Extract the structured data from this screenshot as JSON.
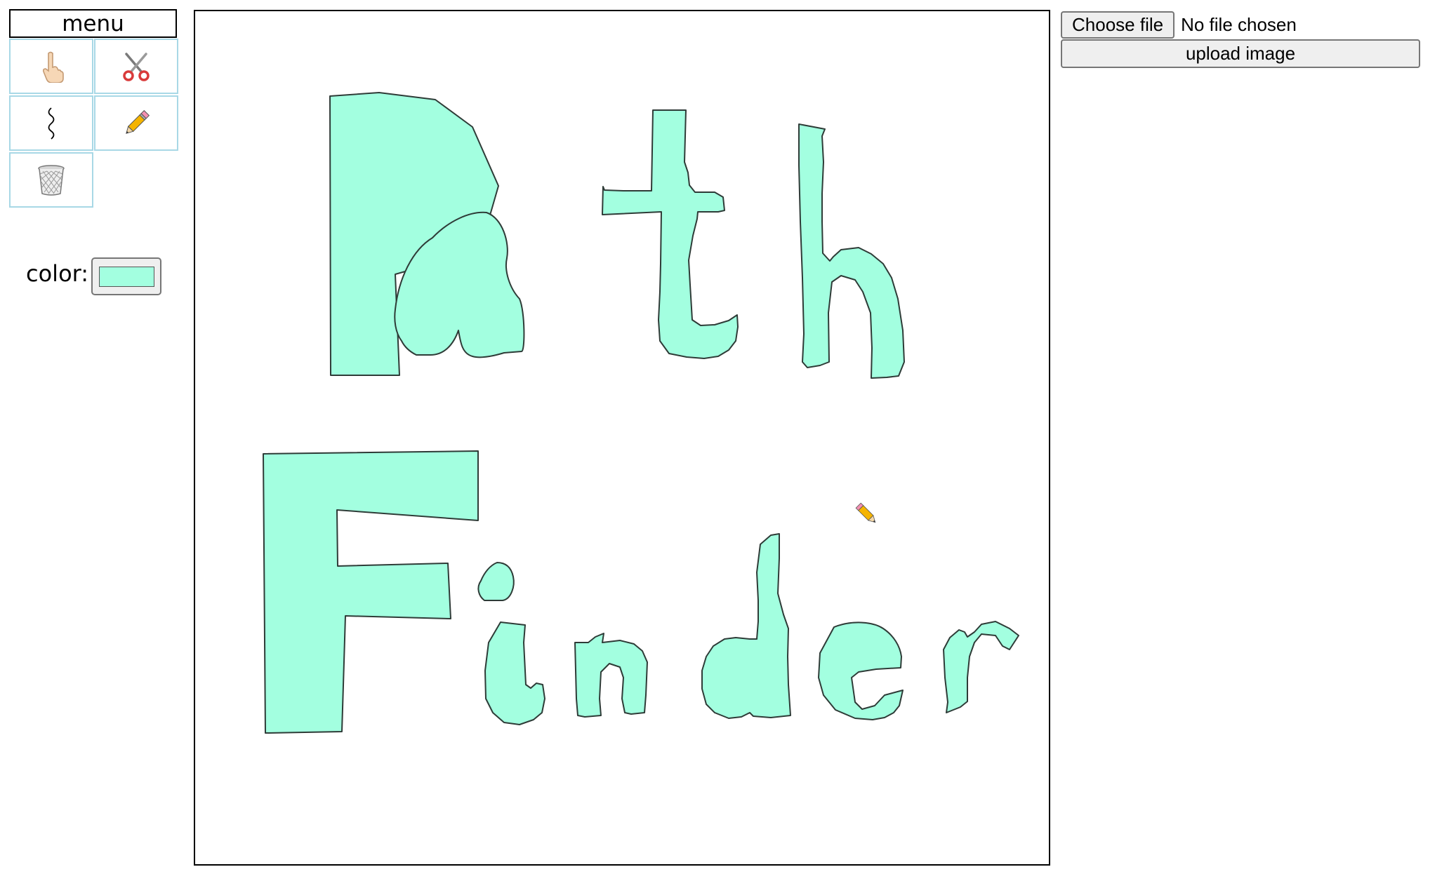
{
  "menu": {
    "title": "menu",
    "tools": [
      {
        "icon": "pointing-hand-icon"
      },
      {
        "icon": "scissors-icon"
      },
      {
        "icon": "squiggle-path-icon"
      },
      {
        "icon": "pencil-icon"
      },
      {
        "icon": "trash-can-icon"
      }
    ],
    "color_label": "color:",
    "color_value": "#a3ffe0"
  },
  "upload": {
    "choose_file_label": "Choose file",
    "file_status": "No file chosen",
    "upload_label": "upload image"
  },
  "canvas": {
    "fill_color": "#a3ffe0",
    "stroke_color": "#2e3b37",
    "cursor_icon": "pencil-cursor-icon"
  }
}
